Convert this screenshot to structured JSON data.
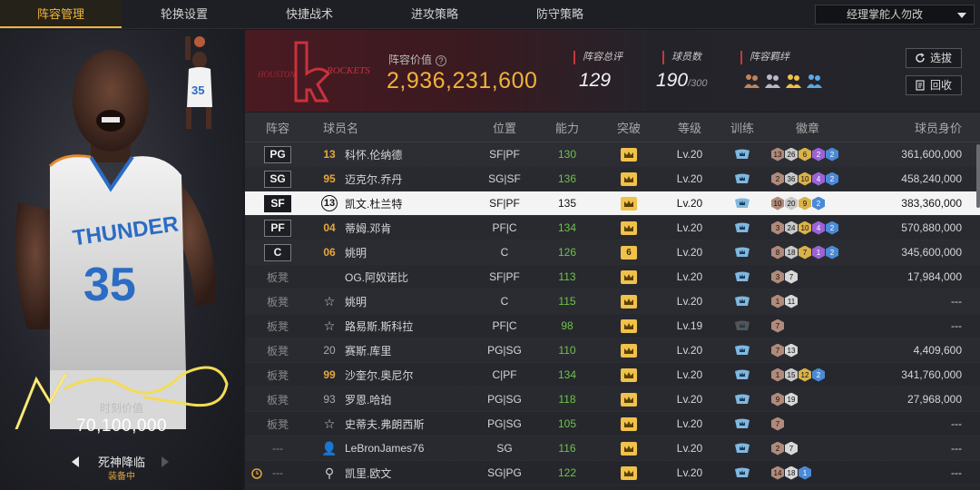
{
  "nav": {
    "tabs": [
      {
        "label": "阵容管理",
        "active": true
      },
      {
        "label": "轮换设置"
      },
      {
        "label": "快捷战术"
      },
      {
        "label": "进攻策略"
      },
      {
        "label": "防守策略"
      }
    ],
    "dropdown": "经理掌舵人勿改"
  },
  "left_panel": {
    "moment_label": "时刻价值",
    "moment_value": "70,100,000",
    "card_name": "死神降临",
    "card_status": "装备中",
    "jersey_text": "THUNDER",
    "jersey_number": "35"
  },
  "header": {
    "lineup_value_label": "阵容价值",
    "lineup_value": "2,936,231,600",
    "overall_label": "阵容总评",
    "overall_value": "129",
    "count_label": "球员数",
    "count_value": "190",
    "count_max": "/300",
    "bond_label": "阵容羁绊",
    "btn_pick": "选拔",
    "btn_recycle": "回收",
    "team_logo_text": "HOUSTON ROCKETS"
  },
  "table": {
    "headers": {
      "pos": "阵容",
      "name": "球员名",
      "position": "位置",
      "ability": "能力",
      "breakthrough": "突破",
      "level": "等级",
      "training": "训练",
      "badge": "徽章",
      "value": "球员身价"
    },
    "rows": [
      {
        "slot": "PG",
        "num": "13",
        "numstyle": "gold",
        "name": "科怀.伦纳德",
        "position": "SF|PF",
        "ability": "130",
        "abil_color": "green",
        "brk": "crown",
        "level": "Lv.20",
        "badges": [
          [
            "bronze",
            "13"
          ],
          [
            "silver",
            "26"
          ],
          [
            "gold",
            "6"
          ],
          [
            "purple",
            "2"
          ],
          [
            "blue",
            "2"
          ]
        ],
        "value": "361,600,000"
      },
      {
        "slot": "SG",
        "num": "95",
        "numstyle": "gold",
        "name": "迈克尔.乔丹",
        "position": "SG|SF",
        "ability": "136",
        "abil_color": "green",
        "brk": "crown",
        "level": "Lv.20",
        "badges": [
          [
            "bronze",
            "2"
          ],
          [
            "silver",
            "36"
          ],
          [
            "gold",
            "10"
          ],
          [
            "purple",
            "4"
          ],
          [
            "blue",
            "2"
          ]
        ],
        "value": "458,240,000"
      },
      {
        "slot": "SF",
        "num": "13",
        "numstyle": "circle",
        "name": "凯文.杜兰特",
        "position": "SF|PF",
        "ability": "135",
        "abil_color": "white",
        "brk": "crown",
        "level": "Lv.20",
        "badges": [
          [
            "bronze",
            "10"
          ],
          [
            "silver",
            "20"
          ],
          [
            "gold",
            "9"
          ],
          [
            "blue",
            "2"
          ]
        ],
        "value": "383,360,000",
        "selected": true
      },
      {
        "slot": "PF",
        "num": "04",
        "numstyle": "gold",
        "name": "蒂姆.邓肯",
        "position": "PF|C",
        "ability": "134",
        "abil_color": "green",
        "brk": "crown",
        "level": "Lv.20",
        "badges": [
          [
            "bronze",
            "3"
          ],
          [
            "silver",
            "24"
          ],
          [
            "gold",
            "10"
          ],
          [
            "purple",
            "4"
          ],
          [
            "blue",
            "2"
          ]
        ],
        "value": "570,880,000"
      },
      {
        "slot": "C",
        "num": "06",
        "numstyle": "gold",
        "name": "姚明",
        "position": "C",
        "ability": "126",
        "abil_color": "green",
        "brk": "6",
        "level": "Lv.20",
        "badges": [
          [
            "bronze",
            "8"
          ],
          [
            "silver",
            "18"
          ],
          [
            "gold",
            "7"
          ],
          [
            "purple",
            "1"
          ],
          [
            "blue",
            "2"
          ]
        ],
        "value": "345,600,000"
      },
      {
        "slot": "板凳",
        "num": "·",
        "numstyle": "none",
        "name": "OG.阿奴诺比",
        "position": "SF|PF",
        "ability": "113",
        "abil_color": "green",
        "brk": "crown",
        "level": "Lv.20",
        "badges": [
          [
            "bronze",
            "3"
          ],
          [
            "gray",
            "7"
          ]
        ],
        "value": "17,984,000"
      },
      {
        "slot": "板凳",
        "num": "☆",
        "numstyle": "star",
        "name": "姚明",
        "position": "C",
        "ability": "115",
        "abil_color": "green",
        "brk": "crown",
        "level": "Lv.20",
        "badges": [
          [
            "bronze",
            "1"
          ],
          [
            "gray",
            "11"
          ]
        ],
        "value": "---"
      },
      {
        "slot": "板凳",
        "num": "☆",
        "numstyle": "star",
        "name": "路易斯.斯科拉",
        "position": "PF|C",
        "ability": "98",
        "abil_color": "green",
        "brk": "crown",
        "level": "Lv.19",
        "badges": [
          [
            "bronze",
            "7"
          ]
        ],
        "value": "---",
        "train_dim": true
      },
      {
        "slot": "板凳",
        "num": "20",
        "numstyle": "gray",
        "name": "赛斯.库里",
        "position": "PG|SG",
        "ability": "110",
        "abil_color": "green",
        "brk": "crown",
        "level": "Lv.20",
        "badges": [
          [
            "bronze",
            "7"
          ],
          [
            "gray",
            "13"
          ]
        ],
        "value": "4,409,600"
      },
      {
        "slot": "板凳",
        "num": "99",
        "numstyle": "gold",
        "name": "沙奎尔.奥尼尔",
        "position": "C|PF",
        "ability": "134",
        "abil_color": "green",
        "brk": "crown",
        "level": "Lv.20",
        "badges": [
          [
            "bronze",
            "1"
          ],
          [
            "silver",
            "15"
          ],
          [
            "gold",
            "12"
          ],
          [
            "blue",
            "2"
          ]
        ],
        "value": "341,760,000"
      },
      {
        "slot": "板凳",
        "num": "93",
        "numstyle": "gray",
        "name": "罗恩.哈珀",
        "position": "PG|SG",
        "ability": "118",
        "abil_color": "green",
        "brk": "crown",
        "level": "Lv.20",
        "badges": [
          [
            "bronze",
            "9"
          ],
          [
            "gray",
            "19"
          ]
        ],
        "value": "27,968,000"
      },
      {
        "slot": "板凳",
        "num": "☆",
        "numstyle": "star",
        "name": "史蒂夫.弗朗西斯",
        "position": "PG|SG",
        "ability": "105",
        "abil_color": "green",
        "brk": "crown",
        "level": "Lv.20",
        "badges": [
          [
            "bronze",
            "7"
          ]
        ],
        "value": "---"
      },
      {
        "slot": "---",
        "num": "👤",
        "numstyle": "person",
        "name": "LeBronJames76",
        "position": "SG",
        "ability": "116",
        "abil_color": "green",
        "brk": "crown",
        "level": "Lv.20",
        "badges": [
          [
            "bronze",
            "2"
          ],
          [
            "gray",
            "7"
          ]
        ],
        "value": "---"
      },
      {
        "slot": "---",
        "num": "⚲",
        "numstyle": "shield",
        "name": "凯里.欧文",
        "position": "SG|PG",
        "ability": "122",
        "abil_color": "green",
        "brk": "crown",
        "level": "Lv.20",
        "badges": [
          [
            "bronze",
            "14"
          ],
          [
            "gray",
            "18"
          ],
          [
            "blue",
            "1"
          ]
        ],
        "value": "---",
        "alarm": true
      }
    ]
  },
  "colors": {
    "accent": "#f2b53a",
    "ability_green": "#6fc24a",
    "selected_bg": "#f4f4f4"
  }
}
